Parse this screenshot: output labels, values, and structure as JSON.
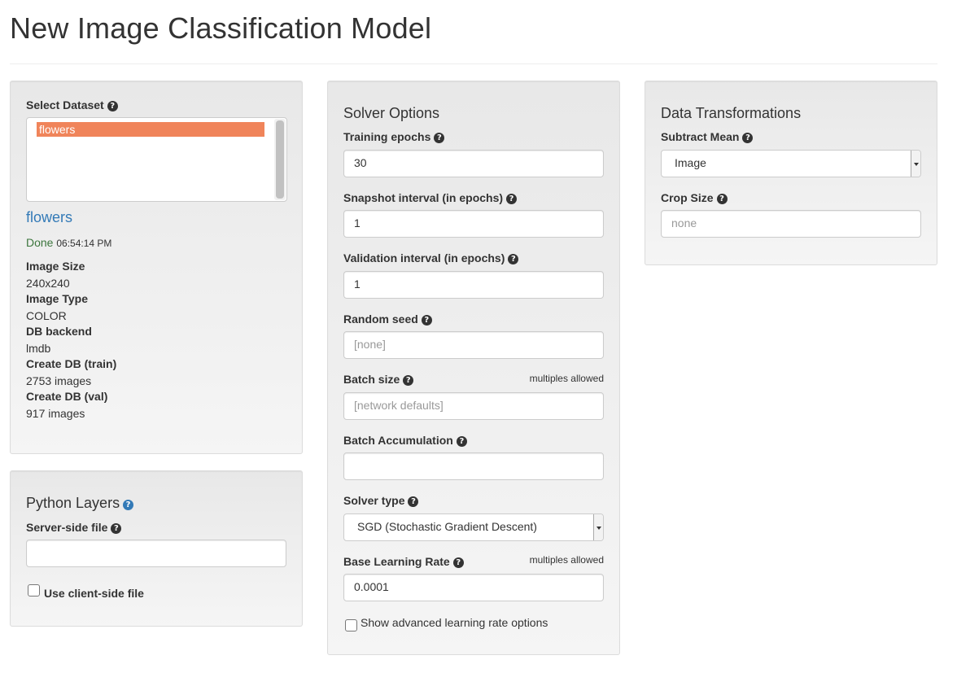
{
  "page": {
    "title": "New Image Classification Model"
  },
  "dataset_panel": {
    "label": "Select Dataset",
    "options": [
      "flowers"
    ],
    "selected": "flowers",
    "dataset_link": "flowers",
    "status": "Done",
    "status_time": "06:54:14 PM",
    "details": [
      {
        "label": "Image Size",
        "value": "240x240"
      },
      {
        "label": "Image Type",
        "value": "COLOR"
      },
      {
        "label": "DB backend",
        "value": "lmdb"
      },
      {
        "label": "Create DB (train)",
        "value": "2753 images"
      },
      {
        "label": "Create DB (val)",
        "value": "917 images"
      }
    ]
  },
  "python_layers": {
    "heading": "Python Layers",
    "server_file_label": "Server-side file",
    "server_file_value": "",
    "client_file_label": "Use client-side file",
    "client_file_checked": false
  },
  "solver": {
    "heading": "Solver Options",
    "training_epochs": {
      "label": "Training epochs",
      "value": "30"
    },
    "snapshot_interval": {
      "label": "Snapshot interval (in epochs)",
      "value": "1"
    },
    "validation_interval": {
      "label": "Validation interval (in epochs)",
      "value": "1"
    },
    "random_seed": {
      "label": "Random seed",
      "placeholder": "[none]"
    },
    "batch_size": {
      "label": "Batch size",
      "note": "multiples allowed",
      "placeholder": "[network defaults]"
    },
    "batch_accumulation": {
      "label": "Batch Accumulation",
      "value": ""
    },
    "solver_type": {
      "label": "Solver type",
      "value": "SGD (Stochastic Gradient Descent)"
    },
    "base_lr": {
      "label": "Base Learning Rate",
      "note": "multiples allowed",
      "value": "0.0001"
    },
    "advanced_lr": {
      "label": "Show advanced learning rate options",
      "checked": false
    }
  },
  "transforms": {
    "heading": "Data Transformations",
    "subtract_mean": {
      "label": "Subtract Mean",
      "value": "Image"
    },
    "crop_size": {
      "label": "Crop Size",
      "placeholder": "none"
    }
  },
  "colors": {
    "accent_link": "#337ab7",
    "selected_option": "#f0845a",
    "status_done": "#3c763d"
  }
}
